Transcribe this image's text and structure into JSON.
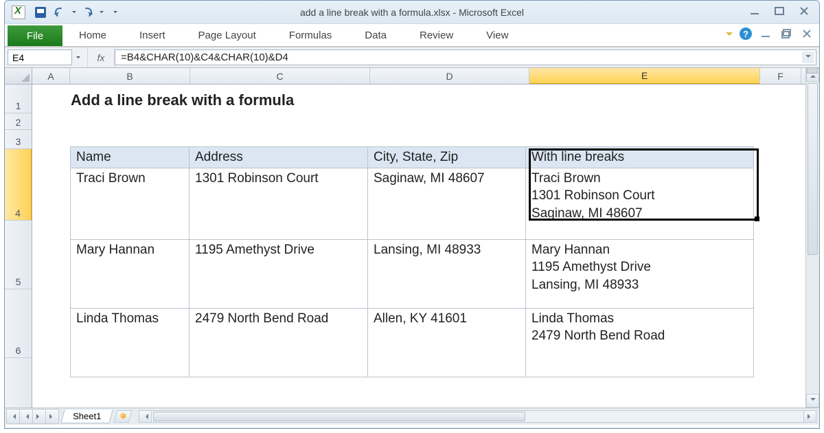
{
  "title_bar": {
    "document": "add a line break with a formula.xlsx  -  Microsoft Excel"
  },
  "ribbon": {
    "file": "File",
    "tabs": [
      "Home",
      "Insert",
      "Page Layout",
      "Formulas",
      "Data",
      "Review",
      "View"
    ]
  },
  "formula_bar": {
    "name_box": "E4",
    "fx": "fx",
    "formula": "=B4&CHAR(10)&C4&CHAR(10)&D4"
  },
  "columns": [
    "A",
    "B",
    "C",
    "D",
    "E",
    "F"
  ],
  "col_widths": {
    "A": 55,
    "B": 175,
    "C": 262,
    "D": 232,
    "E": 336,
    "F": 60
  },
  "selected_col": "E",
  "row_heights": {
    "1": 42,
    "2": 24,
    "3": 28,
    "4": 104,
    "5": 100,
    "6": 100
  },
  "selected_row": "4",
  "body": {
    "title": "Add a line break with a formula",
    "header": [
      "Name",
      "Address",
      "City, State, Zip",
      "With line breaks"
    ],
    "rows": [
      {
        "name": "Traci Brown",
        "address": "1301 Robinson Court",
        "city": "Saginaw, MI 48607",
        "combined": "Traci Brown\n1301 Robinson Court\nSaginaw, MI 48607"
      },
      {
        "name": "Mary Hannan",
        "address": "1195 Amethyst Drive",
        "city": "Lansing, MI 48933",
        "combined": "Mary Hannan\n1195 Amethyst Drive\nLansing, MI 48933"
      },
      {
        "name": "Linda Thomas",
        "address": "2479 North Bend Road",
        "city": "Allen, KY 41601",
        "combined": "Linda Thomas\n2479 North Bend Road"
      }
    ]
  },
  "sheet_tabs": {
    "active": "Sheet1"
  }
}
